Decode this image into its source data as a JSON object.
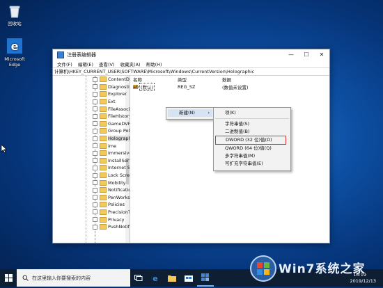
{
  "desktop": {
    "icons": [
      {
        "label": "回收站"
      },
      {
        "label": "Microsoft Edge"
      }
    ]
  },
  "window": {
    "title": "注册表编辑器",
    "minimize": "—",
    "maximize": "☐",
    "close": "✕",
    "menu": [
      "文件(F)",
      "编辑(E)",
      "查看(V)",
      "收藏夹(A)",
      "帮助(H)"
    ],
    "address": "计算机\\HKEY_CURRENT_USER\\SOFTWARE\\Microsoft\\Windows\\CurrentVersion\\Holographic"
  },
  "tree": {
    "items": [
      {
        "label": "ContentDe",
        "selected": false
      },
      {
        "label": "Diagnostic",
        "selected": false
      },
      {
        "label": "Explorer",
        "selected": false
      },
      {
        "label": "Ext",
        "selected": false
      },
      {
        "label": "FileAssoci",
        "selected": false
      },
      {
        "label": "FileHistory",
        "selected": false
      },
      {
        "label": "GameDVR",
        "selected": false
      },
      {
        "label": "Group Pol",
        "selected": false
      },
      {
        "label": "Holographi",
        "selected": true
      },
      {
        "label": "ime",
        "selected": false
      },
      {
        "label": "Immersive",
        "selected": false
      },
      {
        "label": "InstallServ",
        "selected": false
      },
      {
        "label": "Internet Se",
        "selected": false
      },
      {
        "label": "Lock Scree",
        "selected": false
      },
      {
        "label": "Mobility",
        "selected": false
      },
      {
        "label": "Notificatio",
        "selected": false
      },
      {
        "label": "PenWorks",
        "selected": false
      },
      {
        "label": "Policies",
        "selected": false
      },
      {
        "label": "PrecisionT",
        "selected": false
      },
      {
        "label": "Privacy",
        "selected": false
      },
      {
        "label": "PushNotifi",
        "selected": false
      }
    ]
  },
  "list": {
    "columns": {
      "name": "名称",
      "type": "类型",
      "data": "数据"
    },
    "rows": [
      {
        "icon": "ab",
        "name": "(默认)",
        "type": "REG_SZ",
        "data": "(数值未设置)"
      }
    ]
  },
  "context_menu": {
    "new_label": "新建(N)",
    "arrow": "›"
  },
  "submenu": {
    "items": [
      {
        "label": "项(K)",
        "separator_after": true
      },
      {
        "label": "字符串值(S)",
        "separator_after": false
      },
      {
        "label": "二进制值(B)",
        "separator_after": false
      },
      {
        "label": "DWORD (32 位)值(D)",
        "separator_after": false,
        "highlighted": true
      },
      {
        "label": "QWORD (64 位)值(Q)",
        "separator_after": false
      },
      {
        "label": "多字符串值(M)",
        "separator_after": false
      },
      {
        "label": "可扩充字符串值(E)",
        "separator_after": false
      }
    ],
    "highlight_color": "#d9302a"
  },
  "taskbar": {
    "search_placeholder": "在这里输入你要搜索的内容",
    "time": "16:19",
    "date": "2019/12/13"
  },
  "watermark": {
    "text": "Win7系统之家"
  }
}
